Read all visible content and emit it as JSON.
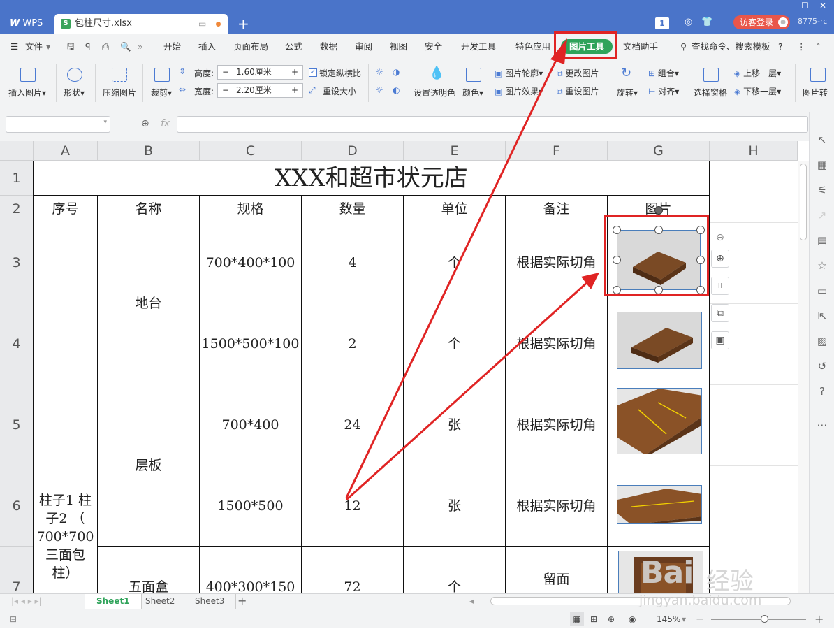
{
  "titlebar": {
    "app_tab": "WPS",
    "file_tab": "包柱尺寸.xlsx",
    "new_tab": "+",
    "notif_count": "1",
    "login_button": "访客登录",
    "user_code": "8775-rc"
  },
  "menu": {
    "file": "文件",
    "items": [
      "开始",
      "插入",
      "页面布局",
      "公式",
      "数据",
      "审阅",
      "视图",
      "安全",
      "开发工具",
      "特色应用",
      "图片工具",
      "文档助手"
    ],
    "active": "图片工具",
    "search": "查找命令、搜索模板",
    "help": "?"
  },
  "ribbon": {
    "insert_picture": "插入图片",
    "shape": "形状",
    "compress": "压缩图片",
    "crop": "裁剪",
    "height_label": "高度:",
    "height_value": "1.60厘米",
    "width_label": "宽度:",
    "width_value": "2.20厘米",
    "lock_ratio": "锁定纵横比",
    "reset_size": "重设大小",
    "set_transparent": "设置透明色",
    "color": "颜色",
    "picture_outline": "图片轮廓",
    "picture_effect": "图片效果",
    "change_picture": "更改图片",
    "reset_picture": "重设图片",
    "rotate": "旋转",
    "group": "组合",
    "align": "对齐",
    "selection_pane": "选择窗格",
    "bring_forward": "上移一层",
    "send_backward": "下移一层",
    "picture_convert": "图片转"
  },
  "formula": {
    "fx": "fx"
  },
  "columns": [
    "A",
    "B",
    "C",
    "D",
    "E",
    "F",
    "G",
    "H"
  ],
  "rows": [
    "1",
    "2",
    "3",
    "4",
    "5",
    "6",
    "7"
  ],
  "sheet": {
    "title": "XXX和超市状元店",
    "headers": [
      "序号",
      "名称",
      "规格",
      "数量",
      "单位",
      "备注",
      "图片"
    ],
    "seq_cell": "柱子1 柱子2 （ 700*700 三面包 柱）",
    "name_ditai": "地台",
    "name_cengban": "层板",
    "name_wumianhe": "五面盒",
    "r3": {
      "spec": "700*400*100",
      "qty": "4",
      "unit": "个",
      "note": "根据实际切角"
    },
    "r4": {
      "spec": "1500*500*100",
      "qty": "2",
      "unit": "个",
      "note": "根据实际切角"
    },
    "r5": {
      "spec": "700*400",
      "qty": "24",
      "unit": "张",
      "note": "根据实际切角"
    },
    "r6": {
      "spec": "1500*500",
      "qty": "12",
      "unit": "张",
      "note": "根据实际切角"
    },
    "r7": {
      "spec": "400*300*150",
      "qty": "72",
      "unit": "个",
      "note": "留面"
    }
  },
  "sheets": [
    "Sheet1",
    "Sheet2",
    "Sheet3"
  ],
  "active_sheet": "Sheet1",
  "status": {
    "zoom": "145%"
  },
  "watermark": {
    "brand": "Bai",
    "brand2": "经验",
    "url": "jingyan.baidu.com"
  },
  "colors": {
    "titlebar": "#4a74c9",
    "active_tab": "#2fa35a",
    "annotation": "#e02424"
  }
}
